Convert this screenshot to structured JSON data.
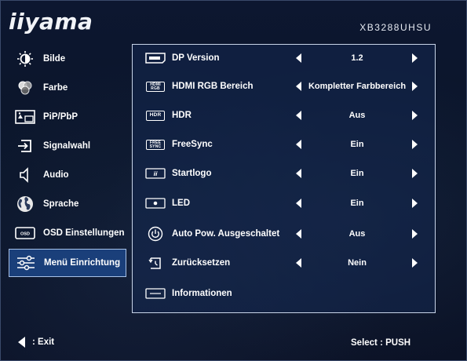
{
  "header": {
    "brand": "iiyama",
    "model": "XB3288UHSU"
  },
  "sidebar": {
    "items": [
      {
        "label": "Bilde",
        "icon": "brightness-icon",
        "active": false
      },
      {
        "label": "Farbe",
        "icon": "color-palette-icon",
        "active": false
      },
      {
        "label": "PiP/PbP",
        "icon": "pip-icon",
        "active": false
      },
      {
        "label": "Signalwahl",
        "icon": "input-source-icon",
        "active": false
      },
      {
        "label": "Audio",
        "icon": "speaker-icon",
        "active": false
      },
      {
        "label": "Sprache",
        "icon": "globe-icon",
        "active": false
      },
      {
        "label": "OSD Einstellungen",
        "icon": "osd-icon",
        "active": false
      },
      {
        "label": "Menü Einrichtung",
        "icon": "sliders-icon",
        "active": true
      }
    ]
  },
  "menu": {
    "rows": [
      {
        "label": "DP Version",
        "value": "1.2",
        "icon": "displayport-icon",
        "badge": ""
      },
      {
        "label": "HDMI RGB Bereich",
        "value": "Kompletter Farbbereich",
        "icon": "hdmi-rgb-icon",
        "badge": "HDMI RGB"
      },
      {
        "label": "HDR",
        "value": "Aus",
        "icon": "hdr-icon",
        "badge": "HDR"
      },
      {
        "label": "FreeSync",
        "value": "Ein",
        "icon": "freesync-icon",
        "badge": "FREE SYNC"
      },
      {
        "label": "Startlogo",
        "value": "Ein",
        "icon": "startlogo-icon",
        "badge": ""
      },
      {
        "label": "LED",
        "value": "Ein",
        "icon": "led-icon",
        "badge": ""
      },
      {
        "label": "Auto Pow. Ausgeschaltet",
        "value": "Aus",
        "icon": "power-icon",
        "badge": ""
      },
      {
        "label": "Zurücksetzen",
        "value": "Nein",
        "icon": "reset-icon",
        "badge": ""
      },
      {
        "label": "Informationen",
        "value": "",
        "icon": "info-icon",
        "badge": ""
      }
    ]
  },
  "footer": {
    "exit": ": Exit",
    "select": "Select  : PUSH"
  },
  "colors": {
    "background": "#0b1428",
    "panel_border": "#c8d4e8",
    "active_item": "#1a3f7a"
  }
}
